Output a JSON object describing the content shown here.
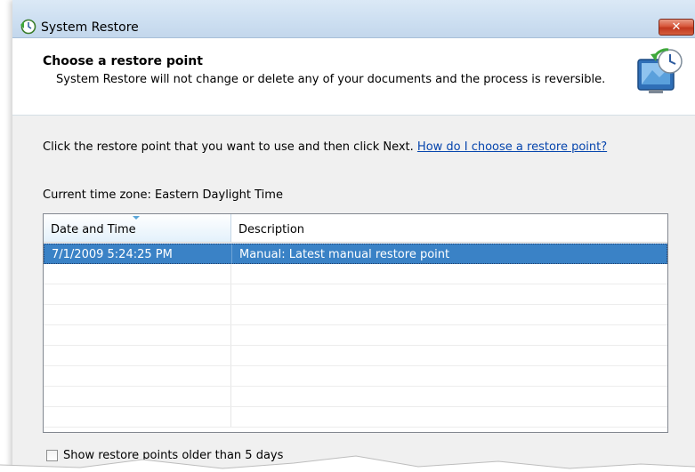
{
  "window": {
    "title": "System Restore",
    "close_label": "✕"
  },
  "header": {
    "title": "Choose a restore point",
    "subtitle": "System Restore will not change or delete any of your documents and the process is reversible."
  },
  "content": {
    "instruction": "Click the restore point that you want to use and then click Next.",
    "help_link": "How do I choose a restore point?",
    "timezone": "Current time zone: Eastern Daylight Time",
    "columns": [
      "Date and Time",
      "Description"
    ],
    "rows": [
      {
        "date": "7/1/2009 5:24:25 PM",
        "description": "Manual: Latest manual restore point",
        "selected": true
      }
    ],
    "show_older_label": "Show restore points older than 5 days",
    "show_older_checked": false
  },
  "colors": {
    "selection": "#3a82c6",
    "link": "#0645ad",
    "close_button": "#c2381e"
  }
}
